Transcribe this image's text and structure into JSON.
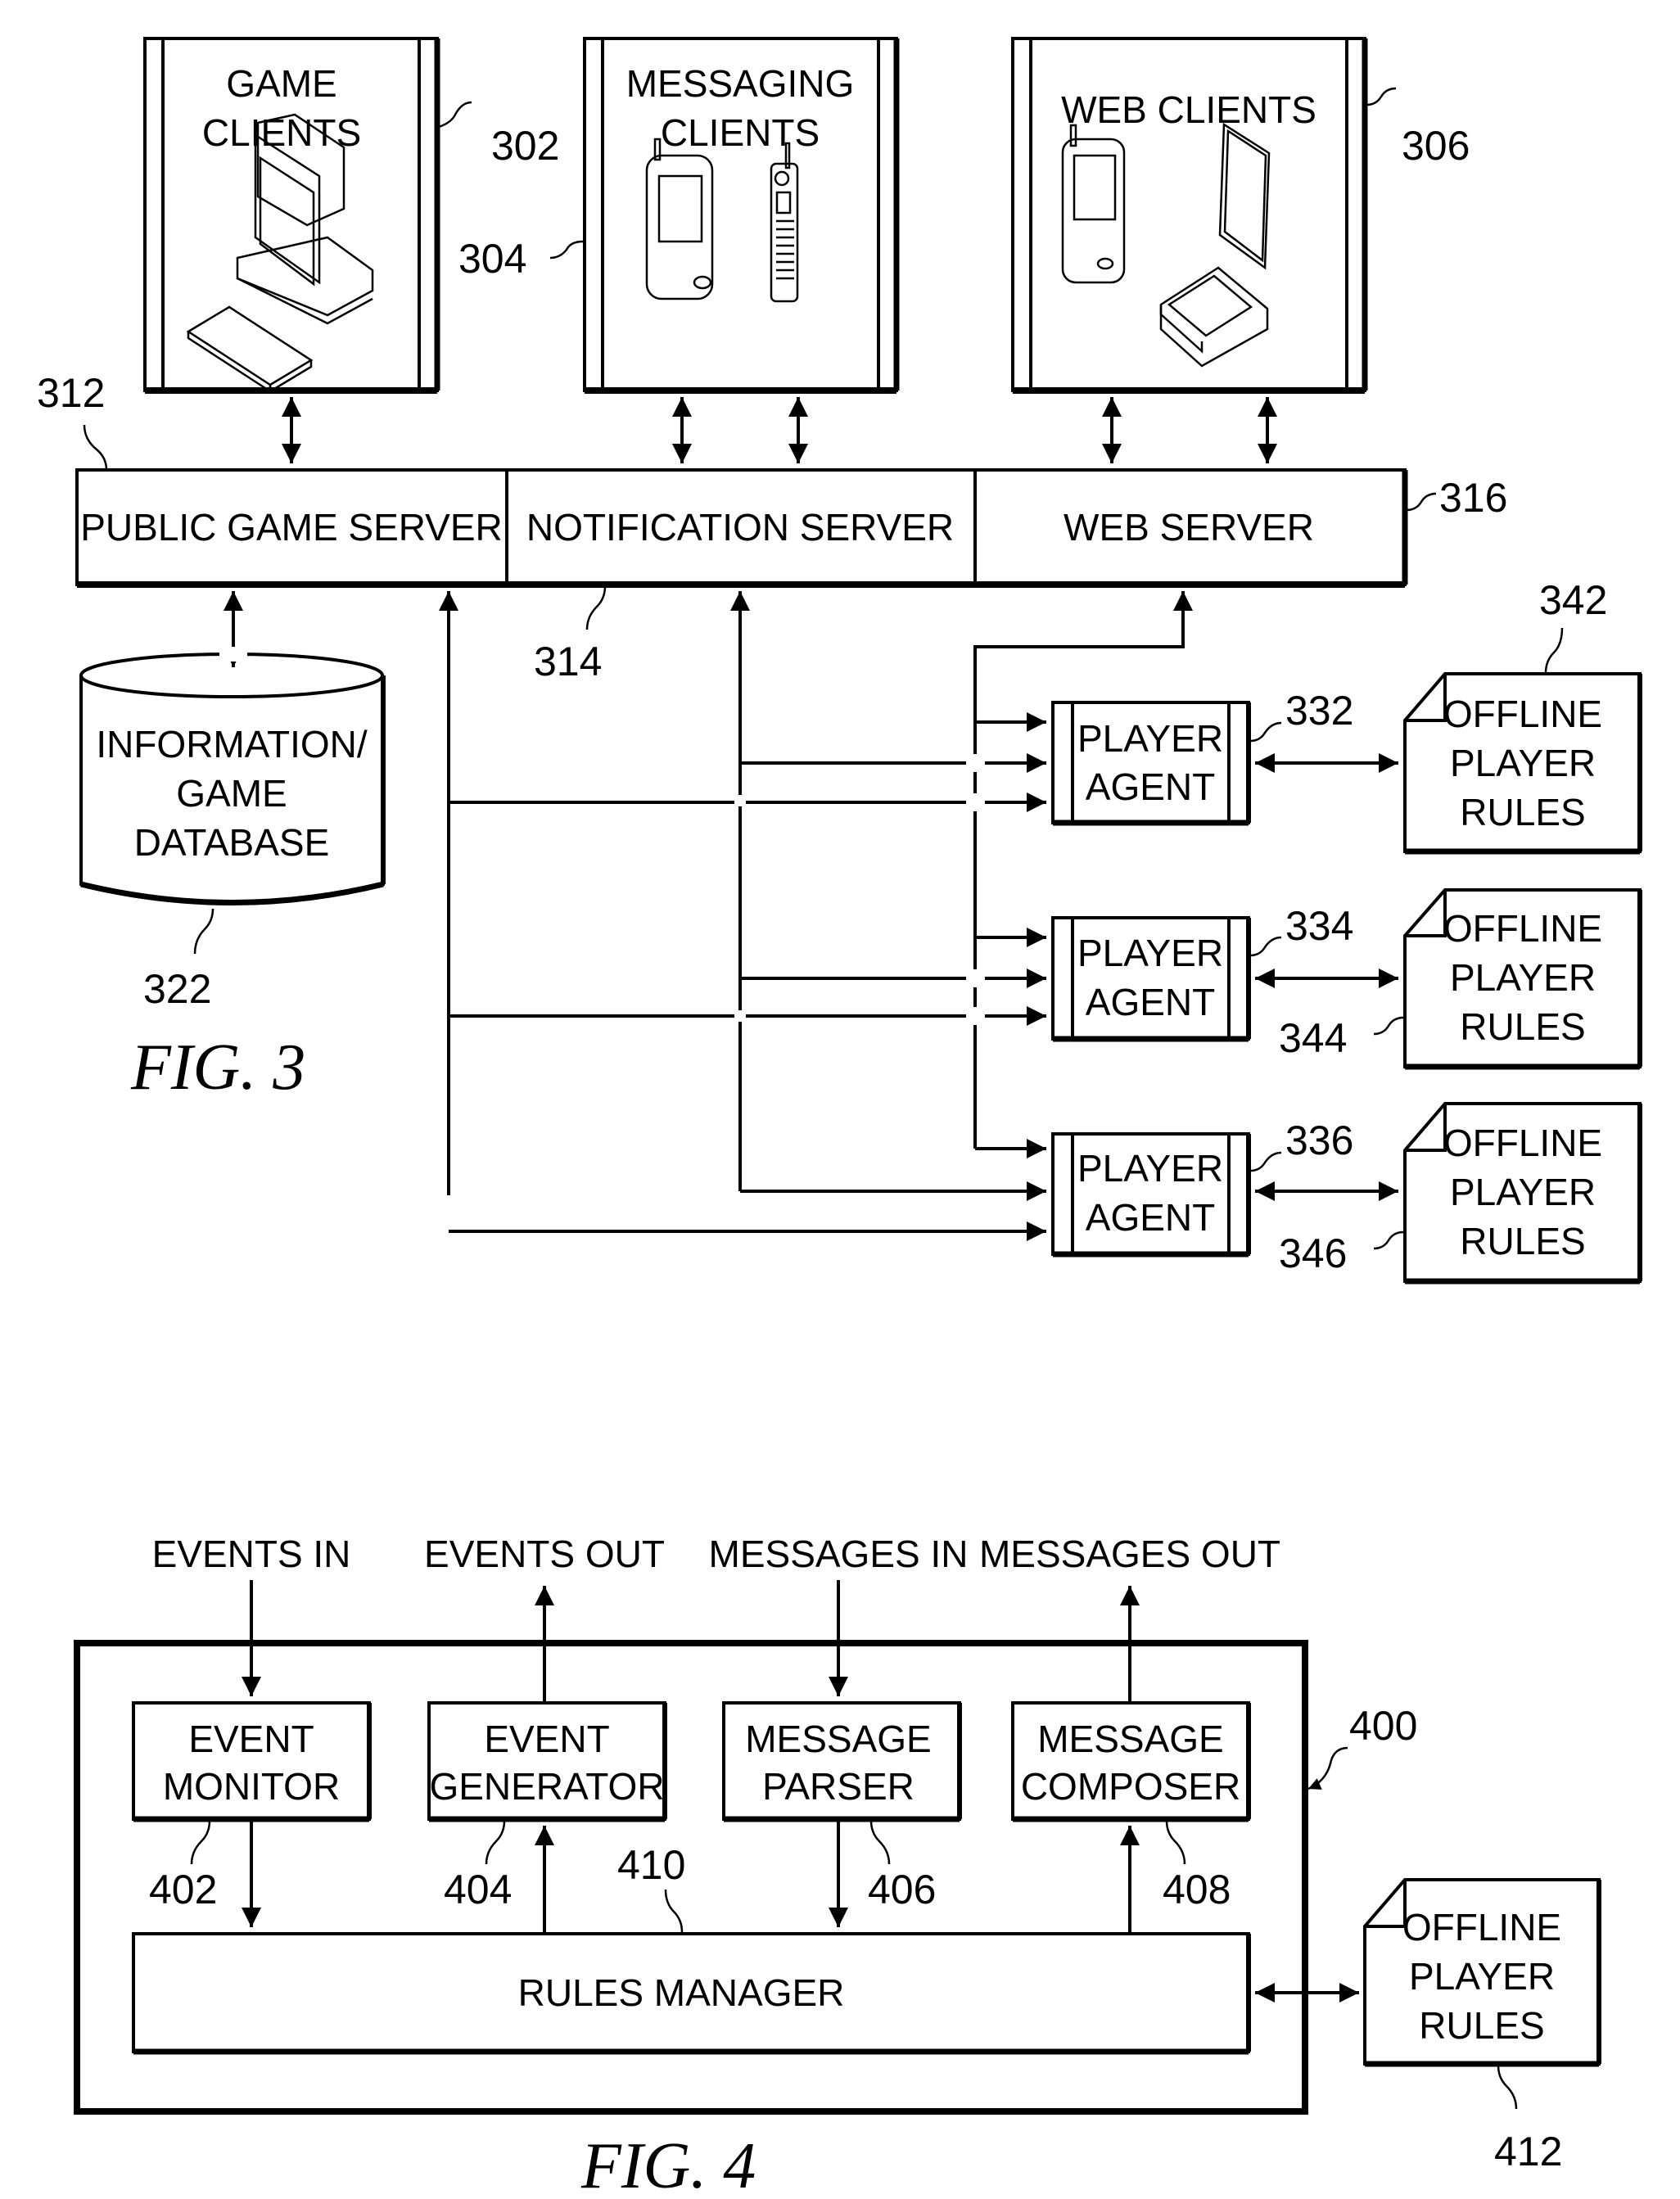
{
  "fig3": {
    "caption": "FIG. 3",
    "clients": [
      {
        "ref": "302",
        "line1": "GAME",
        "line2": "CLIENTS",
        "icon": "desktop-computer-icon"
      },
      {
        "ref": "304",
        "line1": "MESSAGING",
        "line2": "CLIENTS",
        "icon": "mobile-phones-icon"
      },
      {
        "ref": "306",
        "line1": "WEB CLIENTS",
        "line2": "",
        "icon": "pda-laptop-icon"
      }
    ],
    "servers": {
      "public_game_server": {
        "label": "PUBLIC GAME SERVER",
        "ref": "312"
      },
      "notification_server": {
        "label": "NOTIFICATION SERVER",
        "ref": "314"
      },
      "web_server": {
        "label": "WEB SERVER",
        "ref": "316"
      }
    },
    "database": {
      "line1": "INFORMATION/",
      "line2": "GAME",
      "line3": "DATABASE",
      "ref": "322"
    },
    "player_agents": [
      {
        "line1": "PLAYER",
        "line2": "AGENT",
        "ref": "332"
      },
      {
        "line1": "PLAYER",
        "line2": "AGENT",
        "ref": "334"
      },
      {
        "line1": "PLAYER",
        "line2": "AGENT",
        "ref": "336"
      }
    ],
    "offline_rules": [
      {
        "line1": "OFFLINE",
        "line2": "PLAYER",
        "line3": "RULES",
        "ref": "342"
      },
      {
        "line1": "OFFLINE",
        "line2": "PLAYER",
        "line3": "RULES",
        "ref": "344"
      },
      {
        "line1": "OFFLINE",
        "line2": "PLAYER",
        "line3": "RULES",
        "ref": "346"
      }
    ]
  },
  "fig4": {
    "caption": "FIG. 4",
    "container_ref": "400",
    "io_labels": {
      "events_in": "EVENTS IN",
      "events_out": "EVENTS OUT",
      "messages_in": "MESSAGES IN",
      "messages_out": "MESSAGES OUT"
    },
    "modules": [
      {
        "line1": "EVENT",
        "line2": "MONITOR",
        "ref": "402"
      },
      {
        "line1": "EVENT",
        "line2": "GENERATOR",
        "ref": "404"
      },
      {
        "line1": "MESSAGE",
        "line2": "PARSER",
        "ref": "406"
      },
      {
        "line1": "MESSAGE",
        "line2": "COMPOSER",
        "ref": "408"
      }
    ],
    "rules_manager": {
      "label": "RULES MANAGER",
      "ref": "410"
    },
    "offline_rules": {
      "line1": "OFFLINE",
      "line2": "PLAYER",
      "line3": "RULES",
      "ref": "412"
    }
  }
}
